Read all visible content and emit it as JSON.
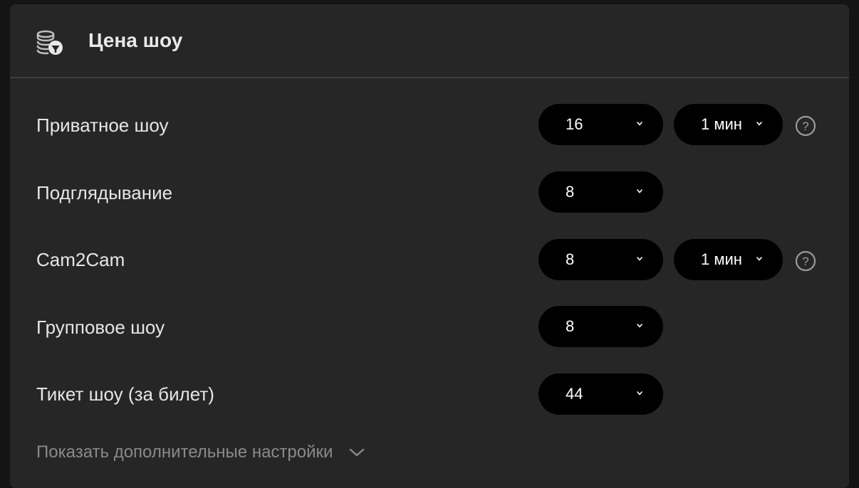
{
  "header": {
    "title": "Цена шоу",
    "icon": "coins-price-tag-icon"
  },
  "rows": [
    {
      "label": "Приватное шоу",
      "price": "16",
      "duration": "1 мин",
      "has_help": true
    },
    {
      "label": "Подглядывание",
      "price": "8"
    },
    {
      "label": "Cam2Cam",
      "price": "8",
      "duration": "1 мин",
      "has_help": true
    },
    {
      "label": "Групповое шоу",
      "price": "8"
    },
    {
      "label": "Тикет шоу (за билет)",
      "price": "44"
    }
  ],
  "more_settings": {
    "label": "Показать дополнительные настройки",
    "icon": "chevron-down-icon"
  },
  "colors": {
    "page_background": "#141414",
    "panel_background": "#262626",
    "select_background": "#000000",
    "label_text": "#e6e6e6",
    "muted_text": "#8a8a8a"
  }
}
